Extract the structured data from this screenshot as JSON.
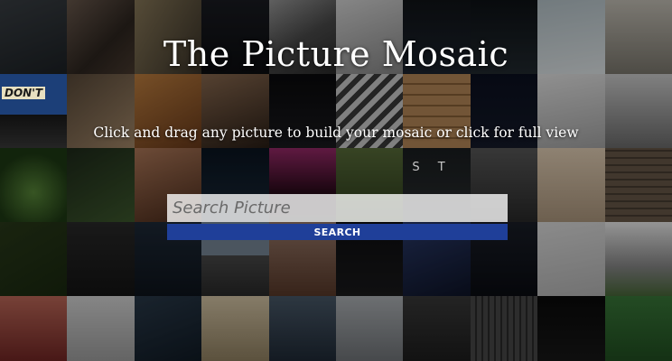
{
  "header": {
    "title": "The Picture Mosaic",
    "subtitle": "Click and drag any picture to build your mosaic or click for full view"
  },
  "search": {
    "placeholder": "Search Picture",
    "button_label": "SEARCH"
  },
  "tile_texts": {
    "sign": "DON'T",
    "letters": "S T"
  },
  "colors": {
    "search_button": "#1f3f99"
  }
}
